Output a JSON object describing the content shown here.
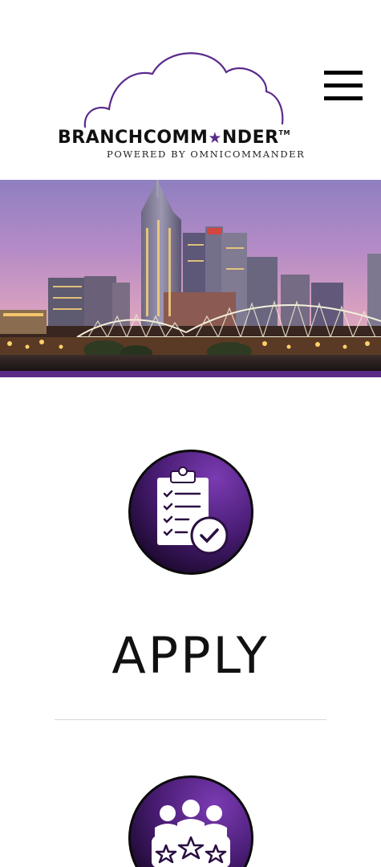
{
  "header": {
    "brand_prefix": "BRANCHCOMM",
    "brand_star": "★",
    "brand_suffix": "NDER",
    "trademark": "TM",
    "tagline": "POWERED BY OMNICOMMANDER",
    "menu_icon": "hamburger-menu-icon"
  },
  "hero": {
    "image": "city-skyline-bridge-at-dusk"
  },
  "sections": [
    {
      "icon": "clipboard-checklist-icon",
      "title": "APPLY"
    },
    {
      "icon": "team-rating-stars-icon",
      "title": ""
    }
  ],
  "colors": {
    "brand_purple": "#5a2a8c",
    "icon_gradient_light": "#7b3bb3",
    "icon_gradient_dark": "#1f0a33",
    "hero_bottom_band": "#5b2a86"
  }
}
